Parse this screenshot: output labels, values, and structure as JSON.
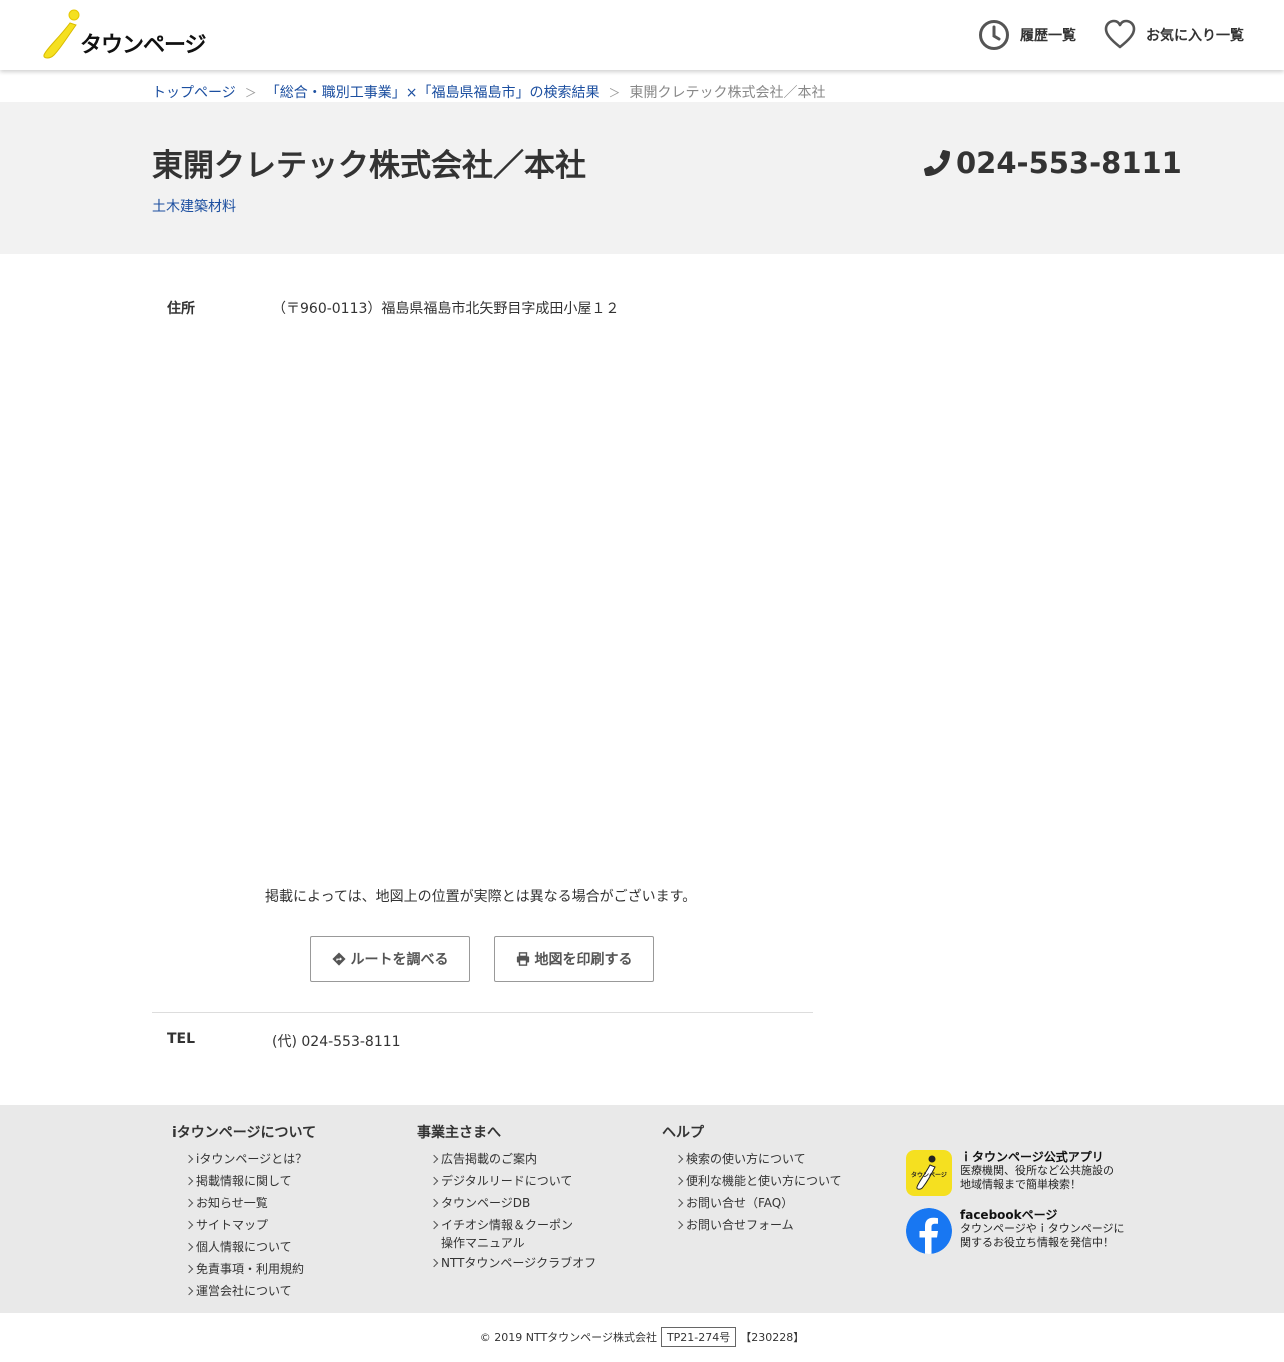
{
  "header": {
    "logo_text": "タウンページ",
    "history_label": "履歴一覧",
    "favorites_label": "お気に入り一覧"
  },
  "breadcrumb": {
    "top": "トップページ",
    "search": "「総合・職別工事業」×「福島県福島市」の検索結果",
    "current": "東開クレテック株式会社／本社",
    "separator": "＞"
  },
  "business": {
    "name": "東開クレテック株式会社／本社",
    "category": "土木建築材料",
    "phone": "024-553-8111"
  },
  "details": {
    "address_label": "住所",
    "address_value": "（〒960-0113）福島県福島市北矢野目字成田小屋１２",
    "map_note": "掲載によっては、地図上の位置が実際とは異なる場合がございます。",
    "route_button": "ルートを調べる",
    "print_button": "地図を印刷する",
    "tel_label": "TEL",
    "tel_value": "(代) 024-553-8111"
  },
  "footer": {
    "columns": [
      {
        "heading": "iタウンページについて",
        "items": [
          "iタウンページとは？",
          "掲載情報に関して",
          "お知らせ一覧",
          "サイトマップ",
          "個人情報について",
          "免責事項・利用規約",
          "運営会社について"
        ]
      },
      {
        "heading": "事業主さまへ",
        "items": [
          "広告掲載のご案内",
          "デジタルリードについて",
          "タウンページDB",
          "イチオシ情報＆クーポン",
          "NTTタウンページクラブオフ"
        ],
        "item3_line2": "操作マニュアル"
      },
      {
        "heading": "ヘルプ",
        "items": [
          "検索の使い方について",
          "便利な機能と使い方について",
          "お問い合せ（FAQ）",
          "お問い合せフォーム"
        ]
      }
    ],
    "app_promo": {
      "title": "ｉタウンページ公式アプリ",
      "line1": "医療機関、役所など公共施設の",
      "line2": "地域情報まで簡単検索！",
      "icon_text": "タウンページ"
    },
    "fb_promo": {
      "title": "facebookページ",
      "line1": "タウンページやｉタウンページに",
      "line2": "関するお役立ち情報を発信中！"
    },
    "copyright": "© 2019 NTTタウンページ株式会社",
    "code": "TP21-274号",
    "version": "【230228】"
  },
  "colors": {
    "link": "#1c4fa0",
    "logo_yellow": "#f5e020",
    "band_bg": "#f2f2f2",
    "footer_bg": "#e9e9e9",
    "facebook": "#1877f2"
  }
}
